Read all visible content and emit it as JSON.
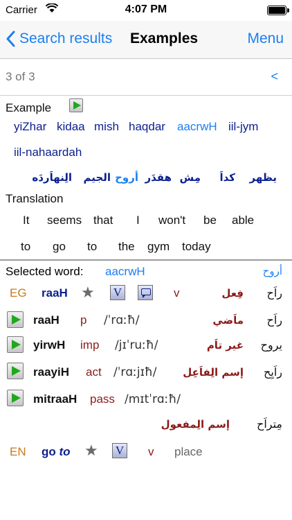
{
  "status": {
    "carrier": "Carrier",
    "time": "4:07 PM"
  },
  "nav": {
    "back_label": "Search results",
    "title": "Examples",
    "menu_label": "Menu"
  },
  "pager": {
    "count": "3 of 3",
    "prev": "<"
  },
  "example": {
    "label": "Example",
    "translit": [
      "yiZhar",
      "kidaa",
      "mish",
      "haqdar",
      "aacrwH",
      "iil-jym",
      "iil-nahaardah"
    ],
    "arabic": [
      "يظهر",
      "كداَ",
      "مِش",
      "هقدَر",
      "أروح",
      "الجيم",
      "الِنهاَردَه"
    ]
  },
  "translation": {
    "label": "Translation",
    "words": [
      "It",
      "seems",
      "that",
      "I",
      "won't",
      "be",
      "able",
      "to",
      "go",
      "to",
      "the",
      "gym",
      "today"
    ]
  },
  "selected": {
    "label": "Selected word:",
    "word": "aacrwH",
    "arabic": "أروح"
  },
  "entry_eg": {
    "lang": "EG",
    "lemma": "raaH",
    "star": "★",
    "v_btn": "V",
    "pos": "v",
    "pos_arabic": "فِعل",
    "lemma_arabic": "راَح"
  },
  "forms": [
    {
      "form": "raaH",
      "type": "p",
      "ipa": "/ˈrɑːħ/",
      "type_arabic": "ماَضي",
      "form_arabic": "راَح"
    },
    {
      "form": "yirwH",
      "type": "imp",
      "ipa": "/jɪˈruːħ/",
      "type_arabic": "غير تاَم",
      "form_arabic": "يروح"
    },
    {
      "form": "raayiH",
      "type": "act",
      "ipa": "/ˈrɑːjɪħ/",
      "type_arabic": "إسم الِفاَعِل",
      "form_arabic": "راَيِح"
    },
    {
      "form": "mitraaH",
      "type": "pass",
      "ipa": "/mɪtˈrɑːħ/",
      "type_arabic": "إسم الِمفعول",
      "form_arabic": "مِتراَح"
    }
  ],
  "entry_en": {
    "lang": "EN",
    "lemma_a": "go",
    "lemma_b": "to",
    "star": "★",
    "v_btn": "V",
    "pos": "v",
    "gloss": "place"
  }
}
